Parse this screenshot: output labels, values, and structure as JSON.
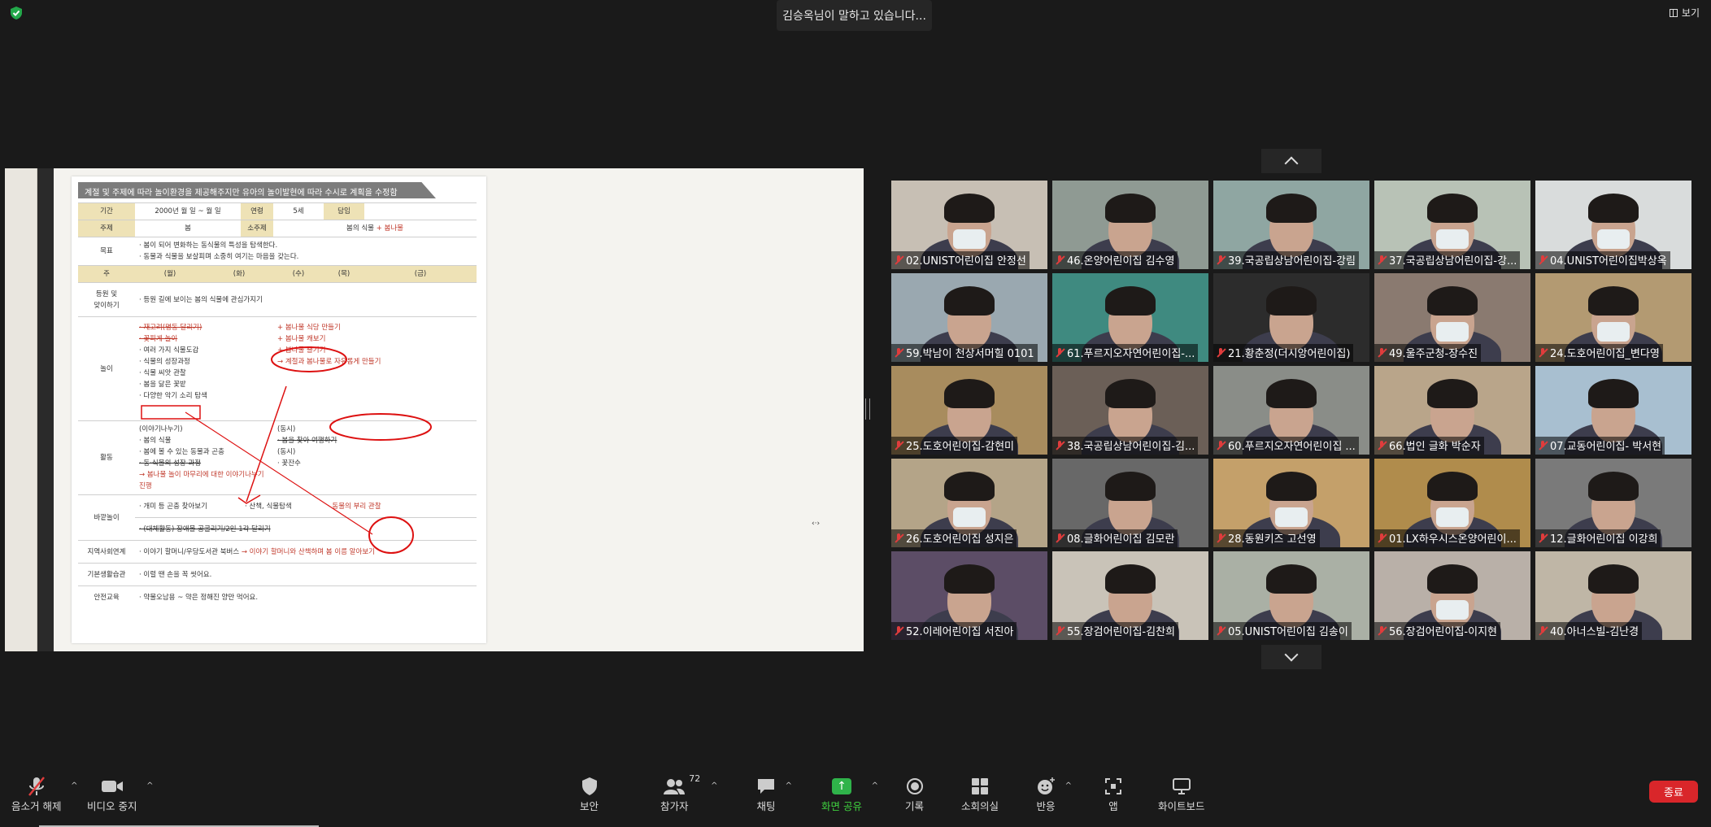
{
  "speaking_banner": "김승옥님이 말하고 있습니다...",
  "view_label": "보기",
  "document": {
    "banner": "계절 및 주제에 따라 놀이환경을 제공해주지만 유아의 놀이발현에 따라 수시로 계획을 수정함",
    "header": {
      "period_label": "기간",
      "period_value": "2000년 월 일 ~ 월 일",
      "age_label": "연령",
      "age_value": "5세",
      "teacher_label": "담임",
      "topic_label": "주제",
      "topic_value": "봄",
      "subtopic_label": "소주제",
      "subtopic_value": "봄의 식물",
      "subtopic_added": "+ 봄나물"
    },
    "goal_label": "목표",
    "goals": [
      "· 봄이 되어 변화하는 동식물의 특성을 탐색한다.",
      "· 동물과 식물을 보살피며 소중히 여기는 마음을 갖는다."
    ],
    "week_label": "주",
    "days": [
      "(월)",
      "(화)",
      "(수)",
      "(목)",
      "(금)"
    ],
    "rows": {
      "arrival_label": "등원 및\n맞이하기",
      "arrival_text": "· 등원 길에 보이는 봄의 식물에 관심가지기",
      "play_label": "놀이",
      "play_items": [
        "· 재고려(명동 달리기)",
        "· 꽃피게 놀이",
        "· 여러 가지 식물도감",
        "· 식물의 성장과정",
        "· 식물 씨앗 관찰",
        "· 봄을 닮은 꽃밭",
        "· 다양한 악기 소리 탐색"
      ],
      "play_notes": [
        "+ 봄나물 식당 만들기",
        "+ 봄나물 캐보기",
        "+ 봄나물 즐기기",
        "→ 계절과 봄나물로 자유롭게 만들기"
      ],
      "activity_label": "활동",
      "activity_left": [
        "(이야기나누기)",
        "· 봄의 식물",
        "· 봄에 볼 수 있는 동물과 곤충",
        "· 동·식물의 성장 과정"
      ],
      "activity_right": [
        "(동시)",
        "· 봄을 찾아 여행하기",
        "(동시)",
        "· 꽃잔수"
      ],
      "activity_note": "→ 봄나물 놀이 마무리에 대한 이야기나누기 진행",
      "outdoor_label": "바깥놀이",
      "outdoor_items": [
        "· 개미 등 곤충 찾아보기",
        "· 산책, 식물탐색",
        "· 동물의 부리 관찰"
      ],
      "outdoor_extra": "· (대체활동) 장애물 공굴리기/2인 1각 달리기",
      "community_label": "지역사회연계",
      "community_text": "· 이야기 할머니/우당도서관 북버스",
      "community_note": "→ 이야기 할머니와 산책하며 봄 이름 알아보기",
      "habit_label": "기본생활습관",
      "habit_text": "· 이럴 땐 손을 꼭 씻어요.",
      "safety_label": "안전교육",
      "safety_text": "· 약물오남용 ~ 약은 정해진 양만 먹어요."
    }
  },
  "participants": [
    {
      "name": "02.UNIST어린이집 안정선",
      "muted": true,
      "mask": true,
      "bg": "#c7bfb4"
    },
    {
      "name": "46.온양어린이집 김수영",
      "muted": true,
      "mask": false,
      "bg": "#8f9a93"
    },
    {
      "name": "39.국공립상남어린이집-강림",
      "muted": true,
      "mask": false,
      "bg": "#8fa6a2"
    },
    {
      "name": "37.국공립상남어린이집-강...",
      "muted": true,
      "mask": true,
      "bg": "#b8c2b6"
    },
    {
      "name": "04.UNIST어린이집박상옥",
      "muted": true,
      "mask": true,
      "bg": "#d9dcdc"
    },
    {
      "name": "59.박남이 천상서머힐 0101",
      "muted": true,
      "mask": false,
      "bg": "#9aa8b0"
    },
    {
      "name": "61.푸르지오자연어린이집-...",
      "muted": true,
      "mask": false,
      "bg": "#3f8a80"
    },
    {
      "name": "21.황춘정(더시앙어린이집)",
      "muted": true,
      "mask": false,
      "bg": "#2c2c2c"
    },
    {
      "name": "49.울주군청-장수진",
      "muted": true,
      "mask": true,
      "bg": "#8a7a70"
    },
    {
      "name": "24.도호어린이집_변다영",
      "muted": true,
      "mask": true,
      "bg": "#b39a72"
    },
    {
      "name": "25.도호어린이집-감현미",
      "muted": true,
      "mask": false,
      "bg": "#a88c5e"
    },
    {
      "name": "38.국공립상남어린이집-김...",
      "muted": true,
      "mask": false,
      "bg": "#6b5f57"
    },
    {
      "name": "60.푸르지오자연어린이집 ...",
      "muted": true,
      "mask": false,
      "bg": "#8a8d88"
    },
    {
      "name": "66.법인 글화 박순자",
      "muted": true,
      "mask": false,
      "bg": "#b9a58a"
    },
    {
      "name": "07.교동어린이집- 박서현",
      "muted": true,
      "mask": false,
      "bg": "#a8bfd0"
    },
    {
      "name": "26.도호어린이집 성지은",
      "muted": true,
      "mask": true,
      "bg": "#b4a488"
    },
    {
      "name": "08.글화어린이집 김모란",
      "muted": true,
      "mask": false,
      "bg": "#686868"
    },
    {
      "name": "28.동원키즈 고선영",
      "muted": true,
      "mask": true,
      "bg": "#c4a06a"
    },
    {
      "name": "01.LX하우시스온양어린이...",
      "muted": true,
      "mask": true,
      "bg": "#b08c4c"
    },
    {
      "name": "12.글화어린이집 이강희",
      "muted": true,
      "mask": false,
      "bg": "#7a7a7a"
    },
    {
      "name": "52.이레어린이집 서진아",
      "muted": true,
      "mask": false,
      "bg": "#5c4d66"
    },
    {
      "name": "55.장검어린이집-김찬희",
      "muted": true,
      "mask": false,
      "bg": "#c9c3b8"
    },
    {
      "name": "05.UNIST어린이집 김송이",
      "muted": true,
      "mask": false,
      "bg": "#aab0a5"
    },
    {
      "name": "56.장검어린이집-이지현",
      "muted": true,
      "mask": true,
      "bg": "#b9b0a8"
    },
    {
      "name": "40.아너스빌-김난경",
      "muted": true,
      "mask": false,
      "bg": "#bfb6a6"
    }
  ],
  "toolbar": {
    "unmute": "음소거 해제",
    "stop_video": "비디오 중지",
    "security": "보안",
    "participants": "참가자",
    "participants_count": "72",
    "chat": "채팅",
    "share_screen": "화면 공유",
    "record": "기록",
    "breakout": "소회의실",
    "reactions": "반응",
    "apps": "앱",
    "whiteboard": "화이트보드",
    "end": "종료"
  }
}
